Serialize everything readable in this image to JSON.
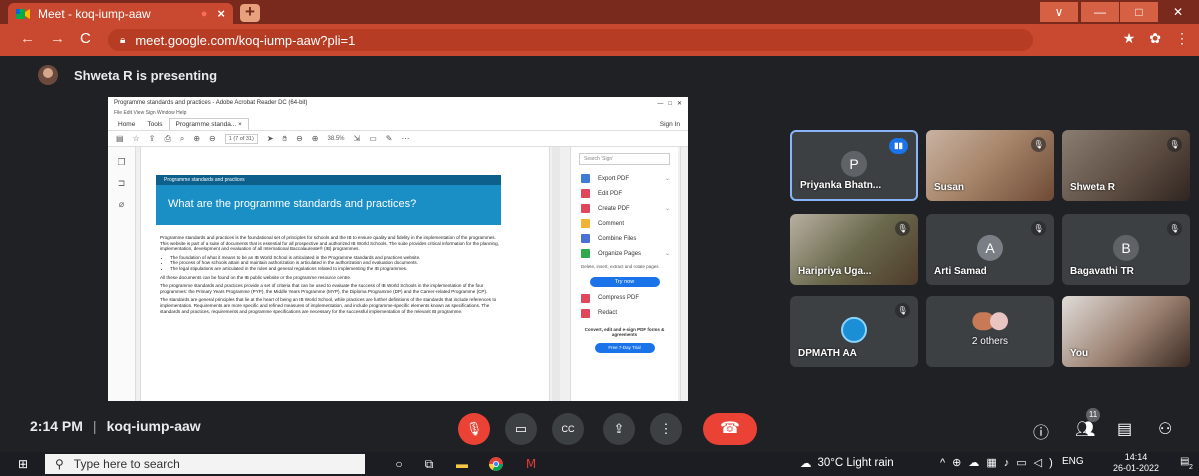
{
  "browser": {
    "tab_title": "Meet - koq-iump-aaw",
    "url": "meet.google.com/koq-iump-aaw?pli=1",
    "new_tab_symbol": "+",
    "window_controls": [
      "∨",
      "—",
      "□",
      "✕"
    ]
  },
  "presenting": {
    "text": "Shweta R is presenting"
  },
  "acrobat": {
    "window_title": "Programme standards and practices - Adobe Acrobat Reader DC (64-bit)",
    "menu": "File  Edit  View  Sign  Window  Help",
    "tabs": [
      "Home",
      "Tools",
      "Programme standa... ×"
    ],
    "sign_in": "Sign In",
    "page_indicator": "1 (7 of 31)",
    "zoom": "38.5%",
    "doc": {
      "banner_small": "Programme standards and practices",
      "banner_title": "What are the programme standards and practices?",
      "para1": "Programme standards and practices is the foundational set of principles for schools and the IB to ensure quality and fidelity in the implementation of the programmes. This website is part of a suite of documents that is essential for all prospective and authorized IB World Schools. The suite provides critical information for the planning, implementation, development and evaluation of all International Baccalaureate® (IB) programmes.",
      "bullets": [
        "The foundation of what it means to be an IB World School is articulated in the Programme standards and practices website.",
        "The process of how schools attain and maintain authorization is articulated in the authorization and evaluation documents.",
        "The legal stipulations are articulated in the rules and general regulations related to implementing the IB programmes."
      ],
      "para2": "All these documents can be found on the IB public website or the programme resource centre.",
      "para3": "The programme standards and practices provide a set of criteria that can be used to evaluate the success of IB World Schools in the implementation of the four programmes: the Primary Years Programme (PYP), the Middle Years Programme (MYP), the Diploma Programme (DP) and the Career-related Programme (CP).",
      "para4": "The standards are general principles that lie at the heart of being an IB World School, while practices are further definitions of the standards that include references to implementation. Requirements are more specific and refined measures of implementation, and include programme-specific elements known as specifications. The standards and practices, requirements and programme specifications are necessary for the successful implementation of the relevant IB programme."
    },
    "panel": {
      "search_placeholder": "Search 'Sign'",
      "tools": [
        {
          "label": "Export PDF",
          "color": "#3d7bd6",
          "chevron": true
        },
        {
          "label": "Edit PDF",
          "color": "#e0475b",
          "chevron": false
        },
        {
          "label": "Create PDF",
          "color": "#e0475b",
          "chevron": true
        },
        {
          "label": "Comment",
          "color": "#f2b234",
          "chevron": false
        },
        {
          "label": "Combine Files",
          "color": "#4a6fd6",
          "chevron": false
        },
        {
          "label": "Organize Pages",
          "color": "#2fa84f",
          "chevron": true
        }
      ],
      "desc": "Delete, insert, extract and rotate pages.",
      "try_now": "Try now",
      "tools2": [
        {
          "label": "Compress PDF",
          "color": "#e0475b"
        },
        {
          "label": "Redact",
          "color": "#e0475b"
        }
      ],
      "promo": "Convert, edit and e-sign PDF forms & agreements",
      "trial": "Free 7-Day Trial"
    }
  },
  "participants": [
    {
      "name": "Priyanka Bhatn...",
      "initial": "P",
      "color": "#5f6368"
    },
    {
      "name": "Susan"
    },
    {
      "name": "Shweta R"
    },
    {
      "name": "Haripriya Uga..."
    },
    {
      "name": "Arti Samad",
      "initial": "A",
      "color": "#7a7f85"
    },
    {
      "name": "Bagavathi TR",
      "initial": "B",
      "color": "#5f6368"
    },
    {
      "name": "DPMATH AA"
    },
    {
      "name": "2 others"
    },
    {
      "name": "You"
    }
  ],
  "meeting": {
    "time": "2:14 PM",
    "code": "koq-iump-aaw",
    "participant_count": "11"
  },
  "taskbar": {
    "search_placeholder": "Type here to search",
    "weather": "30°C  Light rain",
    "lang": "ENG",
    "time": "14:14",
    "date": "26-01-2022",
    "notif": "2"
  },
  "colors": {
    "chrome_accent": "#c8492f",
    "meet_bg": "#202124",
    "hangup": "#ea4335"
  }
}
